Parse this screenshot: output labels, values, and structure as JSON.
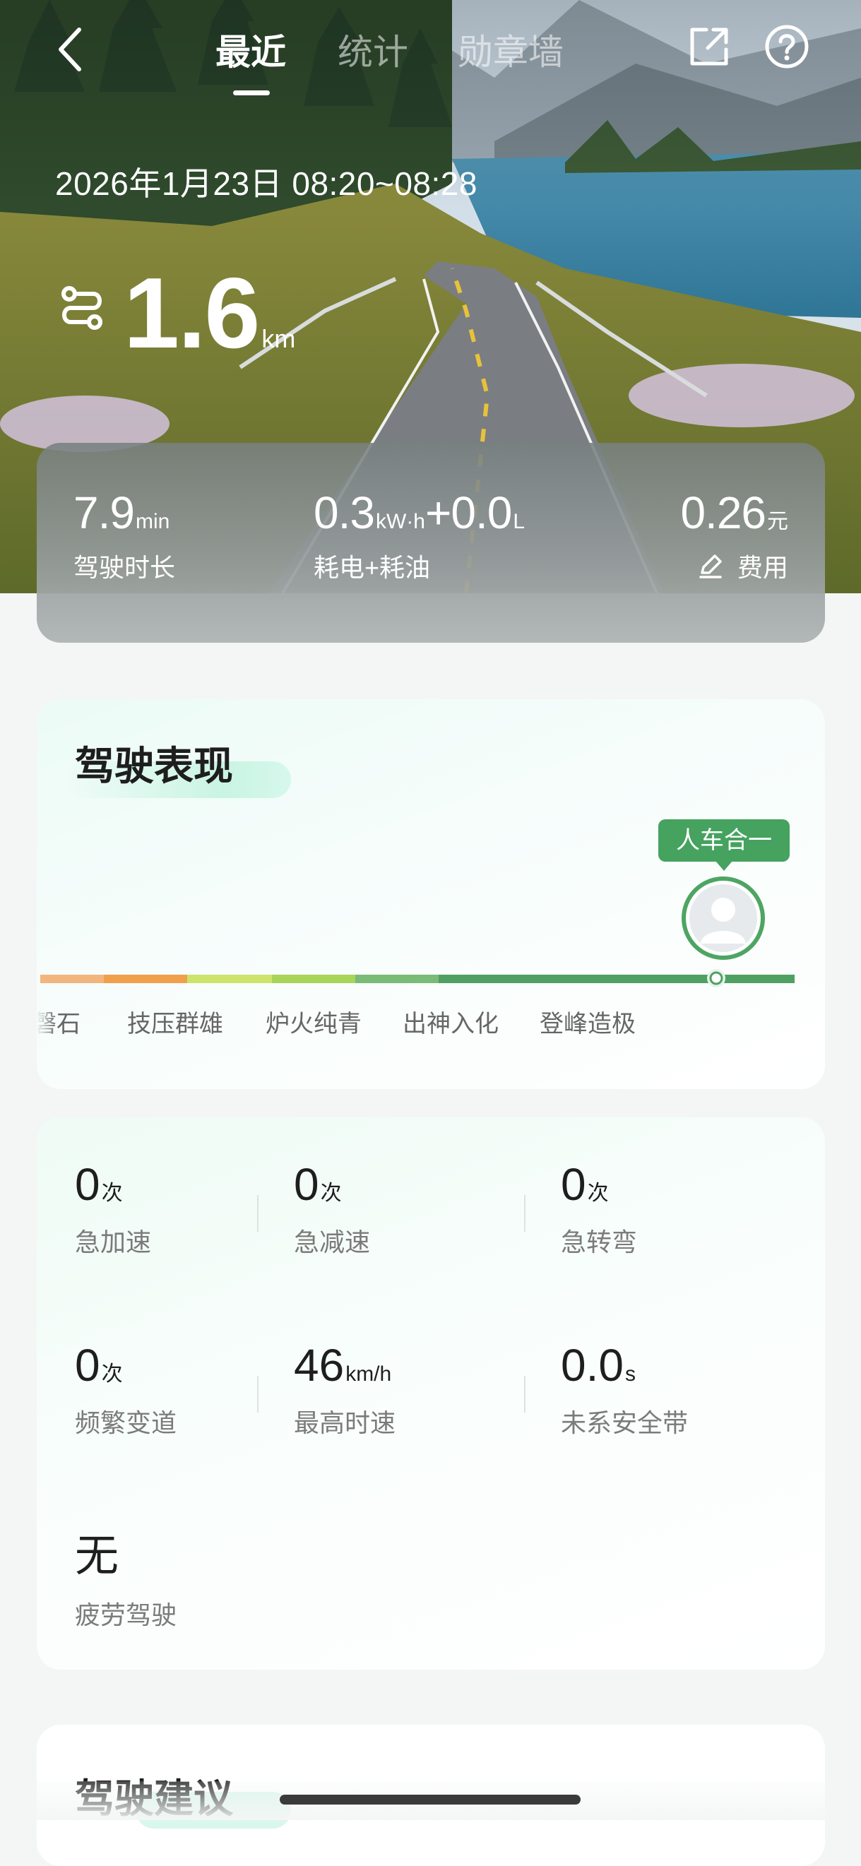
{
  "header": {
    "tabs": [
      {
        "label": "最近",
        "active": true
      },
      {
        "label": "统计",
        "active": false
      },
      {
        "label": "勋章墙",
        "active": false
      }
    ],
    "back_icon": "chevron-left-icon",
    "share_icon": "share-icon",
    "help_icon": "help-icon"
  },
  "trip": {
    "time_range": "2026年1月23日 08:20~08:28",
    "distance_value": "1.6",
    "distance_unit": "km"
  },
  "summary": {
    "duration": {
      "value": "7.9",
      "unit": "min",
      "label": "驾驶时长"
    },
    "energy": {
      "electric_value": "0.3",
      "electric_unit": "kW·h",
      "plus": "+",
      "fuel_value": "0.0",
      "fuel_unit": "L",
      "label": "耗电+耗油"
    },
    "cost": {
      "value": "0.26",
      "unit": "元",
      "label": "费用"
    }
  },
  "performance": {
    "title": "驾驶表现",
    "current_level": "人车合一",
    "levels": [
      "磐石",
      "技压群雄",
      "炉火纯青",
      "出神入化",
      "登峰造极"
    ],
    "visible_first_level_fragment": "磬石",
    "colors": [
      "#f2b57e",
      "#f0a04b",
      "#cde46b",
      "#a9d45a",
      "#79bb77",
      "#4fa062"
    ]
  },
  "events": {
    "hard_accel": {
      "value": "0",
      "unit": "次",
      "label": "急加速"
    },
    "hard_brake": {
      "value": "0",
      "unit": "次",
      "label": "急减速"
    },
    "sharp_turn": {
      "value": "0",
      "unit": "次",
      "label": "急转弯"
    },
    "lane_change": {
      "value": "0",
      "unit": "次",
      "label": "频繁变道"
    },
    "top_speed": {
      "value": "46",
      "unit": "km/h",
      "label": "最高时速"
    },
    "no_seatbelt": {
      "value": "0.0",
      "unit": "s",
      "label": "未系安全带"
    },
    "fatigue": {
      "value": "无",
      "label": "疲劳驾驶"
    }
  },
  "advice": {
    "title": "驾驶建议"
  }
}
